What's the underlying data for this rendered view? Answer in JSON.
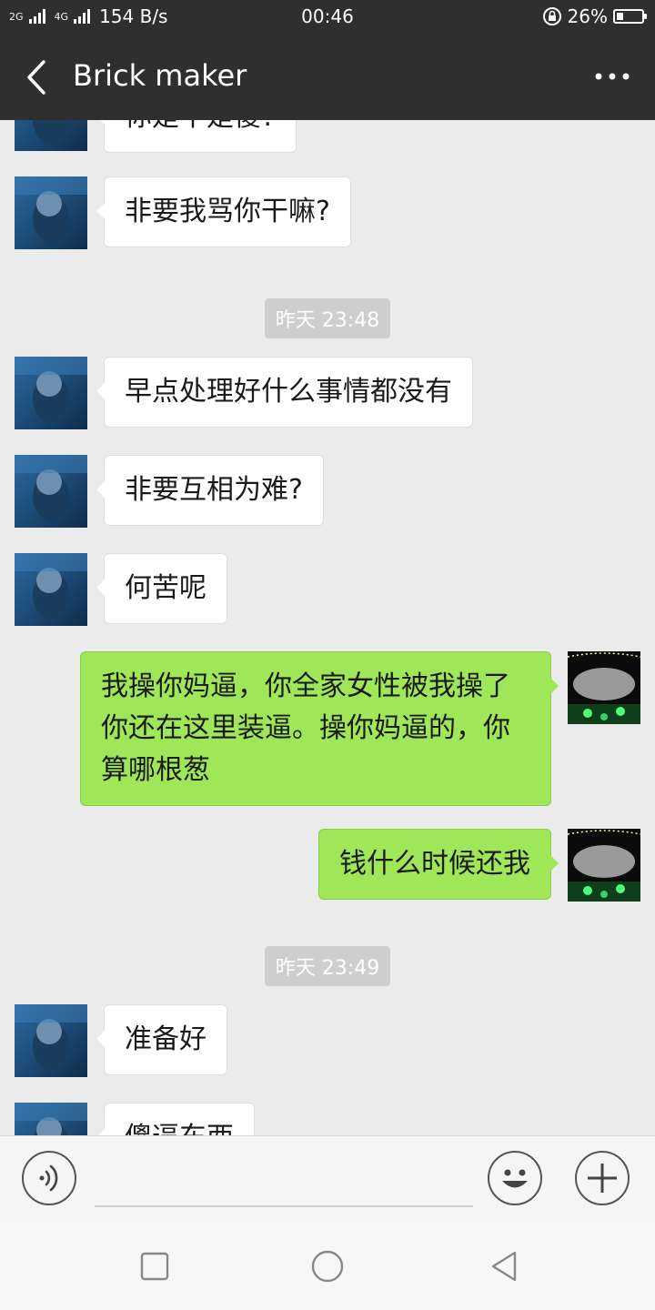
{
  "status_bar": {
    "signal_1": "2G",
    "signal_2": "4G",
    "speed": "154 B/s",
    "time": "00:46",
    "battery": "26%",
    "battery_fraction": 0.26
  },
  "header": {
    "title": "Brick maker",
    "back_icon": "chevron-left-icon",
    "more_icon": "more-horizontal-icon"
  },
  "chat": {
    "messages": [
      {
        "type": "text",
        "side": "left",
        "text": "你是不是傻?"
      },
      {
        "type": "text",
        "side": "left",
        "text": "非要我骂你干嘛?"
      },
      {
        "type": "time",
        "text": "昨天 23:48"
      },
      {
        "type": "text",
        "side": "left",
        "text": "早点处理好什么事情都没有"
      },
      {
        "type": "text",
        "side": "left",
        "text": "非要互相为难?"
      },
      {
        "type": "text",
        "side": "left",
        "text": "何苦呢"
      },
      {
        "type": "text",
        "side": "right",
        "text": "我操你妈逼，你全家女性被我操了你还在这里装逼。操你妈逼的，你算哪根葱"
      },
      {
        "type": "text",
        "side": "right",
        "text": "钱什么时候还我"
      },
      {
        "type": "time",
        "text": "昨天 23:49"
      },
      {
        "type": "text",
        "side": "left",
        "text": "准备好"
      },
      {
        "type": "text",
        "side": "left",
        "text": "傻逼东西"
      }
    ]
  },
  "input_bar": {
    "voice_icon": "voice-icon",
    "emoji_icon": "emoji-icon",
    "plus_icon": "plus-icon",
    "placeholder": ""
  },
  "nav_bar": {
    "recent_icon": "square-icon",
    "home_icon": "circle-icon",
    "back_icon": "triangle-back-icon"
  }
}
